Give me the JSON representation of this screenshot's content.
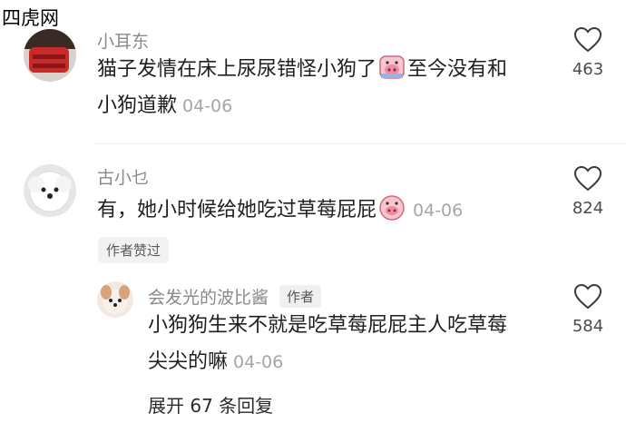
{
  "watermark": "四虎网",
  "comments": [
    {
      "username": "小耳东",
      "line1": "猫子发情在床上尿尿错怪小狗了",
      "line1_after": "至今没有和",
      "line2": "小狗道歉",
      "date": "04-06",
      "likes": "463"
    },
    {
      "username": "古小乜",
      "line1": "有，她小时候给她吃过草莓屁屁",
      "date": "04-06",
      "likes": "824",
      "badge": "作者赞过"
    }
  ],
  "reply": {
    "username": "会发光的波比酱",
    "author_tag": "作者",
    "line1": "小狗狗生来不就是吃草莓屁屁主人吃草莓",
    "line2": "尖尖的嘛",
    "date": "04-06",
    "likes": "584"
  },
  "expand_label": "展开 67 条回复",
  "colors": {
    "text": "#1f1f1f",
    "meta": "#8a8a8a",
    "date": "#a6a6a6"
  },
  "icons": [
    "heart-outline-icon",
    "pig-face-emoji-icon"
  ]
}
